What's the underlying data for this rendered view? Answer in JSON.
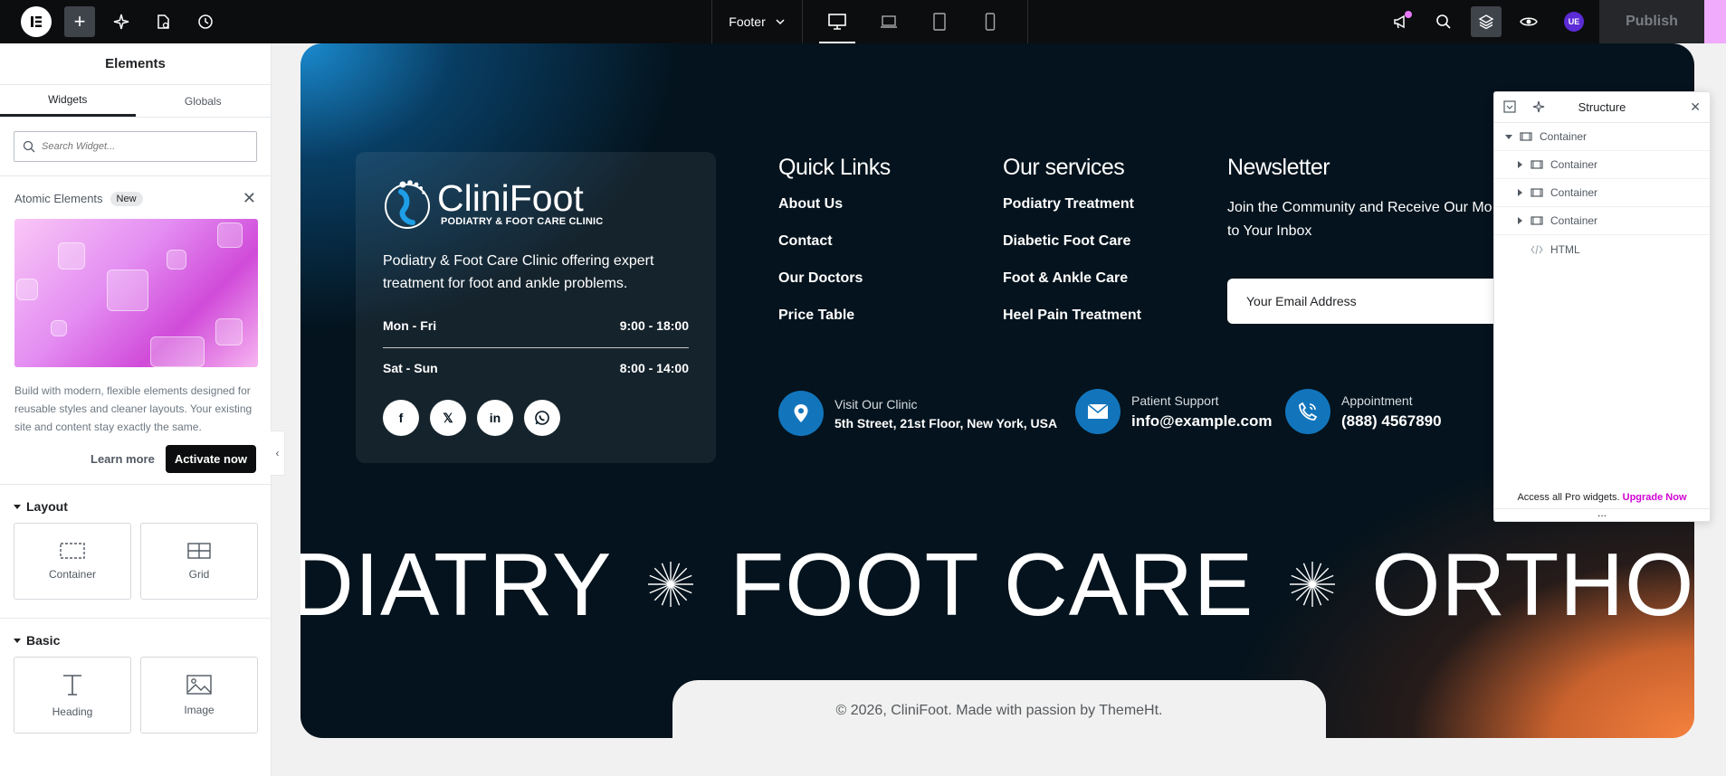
{
  "topbar": {
    "document_title": "Footer",
    "publish_label": "Publish",
    "user_initials": "UE"
  },
  "panel": {
    "title": "Elements",
    "tabs": [
      "Widgets",
      "Globals"
    ],
    "search_placeholder": "Search Widget...",
    "atomic": {
      "title": "Atomic Elements",
      "badge": "New",
      "description": "Build with modern, flexible elements designed for reusable styles and cleaner layouts. Your existing site and content stay exactly the same.",
      "learn_more": "Learn more",
      "activate": "Activate now"
    },
    "sections": [
      {
        "title": "Layout",
        "widgets": [
          "Container",
          "Grid"
        ]
      },
      {
        "title": "Basic",
        "widgets": [
          "Heading",
          "Image"
        ]
      }
    ]
  },
  "footer": {
    "brand_name": "CliniFoot",
    "brand_tagline": "PODIATRY & FOOT CARE CLINIC",
    "description": "Podiatry & Foot Care Clinic offering expert treatment for foot and ankle problems.",
    "hours": [
      {
        "days": "Mon - Fri",
        "time": "9:00 - 18:00"
      },
      {
        "days": "Sat - Sun",
        "time": "8:00 - 14:00"
      }
    ],
    "socials": [
      "facebook",
      "x",
      "linkedin",
      "whatsapp"
    ],
    "quick_links": {
      "title": "Quick Links",
      "items": [
        "About Us",
        "Contact",
        "Our Doctors",
        "Price Table"
      ]
    },
    "services": {
      "title": "Our services",
      "items": [
        "Podiatry Treatment",
        "Diabetic Foot Care",
        "Foot & Ankle Care",
        "Heel Pain Treatment"
      ]
    },
    "newsletter": {
      "title": "Newsletter",
      "description": "Join the Community and Receive Our Mo Straight to Your Inbox",
      "email_placeholder": "Your Email Address"
    },
    "contacts": [
      {
        "label": "Visit Our Clinic",
        "value": "5th Street, 21st Floor, New York, USA",
        "icon": "map-pin-icon"
      },
      {
        "label": "Patient Support",
        "value": "info@example.com",
        "icon": "envelope-icon"
      },
      {
        "label": "Appointment",
        "value": "(888) 4567890",
        "icon": "phone-icon"
      }
    ],
    "marquee": [
      "DIATRY",
      "FOOT CARE",
      "ORTHOTIC"
    ],
    "copyright": "© 2026, CliniFoot. Made with passion by ThemeHt."
  },
  "structure": {
    "title": "Structure",
    "tree": [
      {
        "label": "Container",
        "level": 0,
        "toggle": "open"
      },
      {
        "label": "Container",
        "level": 1,
        "toggle": "closed"
      },
      {
        "label": "Container",
        "level": 1,
        "toggle": "closed"
      },
      {
        "label": "Container",
        "level": 1,
        "toggle": "closed"
      },
      {
        "label": "HTML",
        "level": 1,
        "toggle": "none"
      }
    ],
    "footer_text": "Access all Pro widgets.",
    "footer_link": "Upgrade Now"
  },
  "colors": {
    "accent_blue": "#1275bc",
    "accent_orange": "#f5813e",
    "footer_bg": "#04131d",
    "upgrade_link": "#d004d4"
  }
}
